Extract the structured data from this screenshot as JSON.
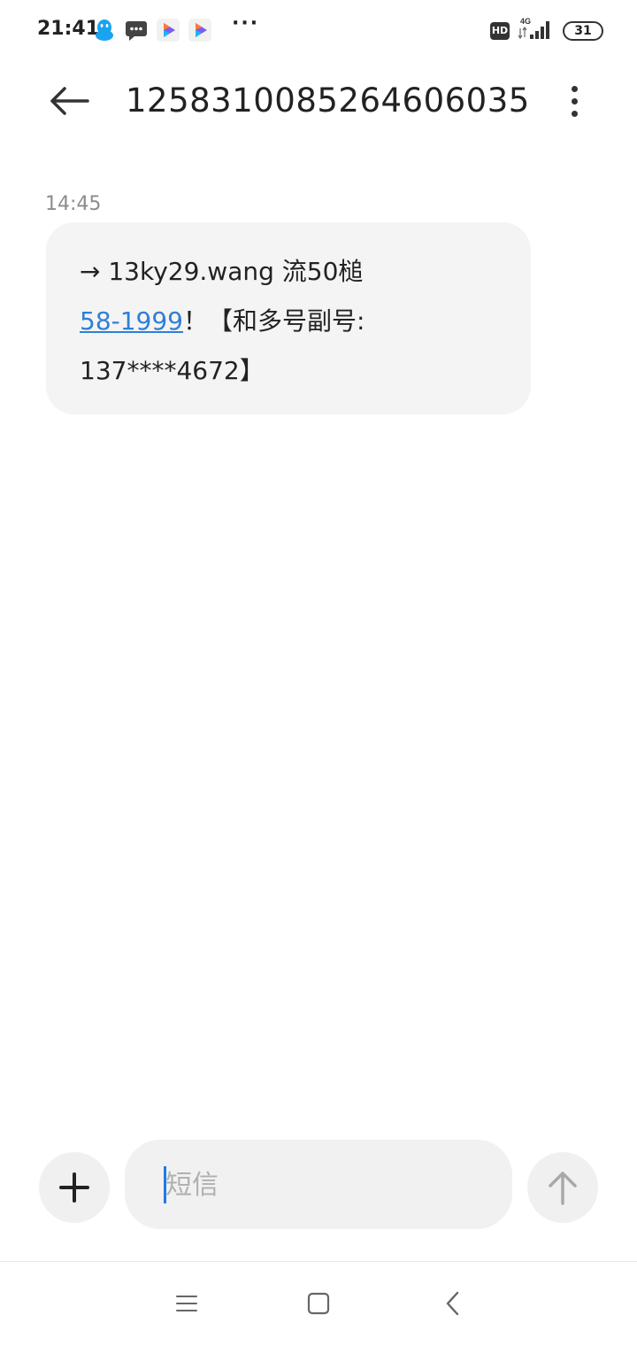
{
  "status_bar": {
    "time": "21:41",
    "more": "···",
    "hd": "HD",
    "network": "4G",
    "battery": "31",
    "icons": [
      "qq-icon",
      "message-icon",
      "video-app-icon",
      "video-app-icon"
    ]
  },
  "header": {
    "title": "1258310085264606035"
  },
  "conversation": {
    "messages": [
      {
        "time": "14:45",
        "line1": "→ 13ky29.wang 流50槌",
        "link": "58-1999",
        "line2_rest": "！【和多号副号:",
        "line3": "137****4672】"
      }
    ]
  },
  "composer": {
    "placeholder": "短信"
  },
  "colors": {
    "link": "#2f7fd6",
    "bubble": "#f4f4f4",
    "caret": "#1e7be6"
  }
}
